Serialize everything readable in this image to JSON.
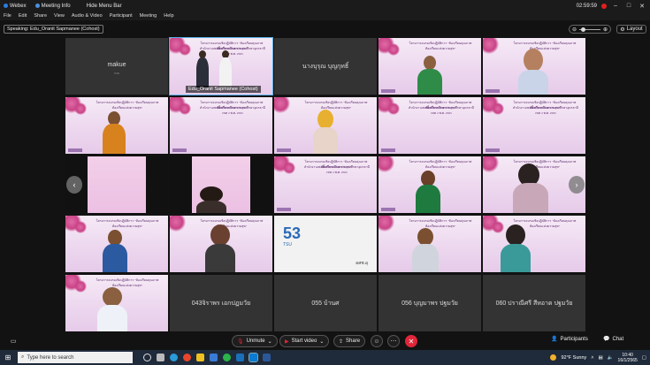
{
  "titlebar": {
    "app_name": "Webex",
    "meeting_info": "Meeting Info",
    "hide_menu_bar": "Hide Menu Bar",
    "timer": "02:59:59",
    "min": "–",
    "max": "□",
    "close": "✕"
  },
  "menu": [
    "File",
    "Edit",
    "Share",
    "View",
    "Audio & Video",
    "Participant",
    "Meeting",
    "Help"
  ],
  "speaking": "Speaking: Edu_Oranit Sapmanee (Cohost)",
  "layout_label": "Layout",
  "slide_title": "โครงการอบรมเชิงปฏิบัติการ \"ห้องเรียนคุณภาพ ห้องเรียนแห่งความสุข\"",
  "slide_subtitle": "สำนักงานเขตพื้นที่การศึกษาประถมศึกษาอุดรธานี เขต 2 พ.ศ. 2565",
  "tiles": {
    "t1_name": "makue",
    "t1_sub": "ma",
    "t2_name": "Edu_Oranit Sapmanee (Cohost)",
    "t3_name": "นางบุรุณ บุญกุทธิ์",
    "t21_name": "043จิราพร เอกปฏมวัย",
    "t22_name": "055 บ้านศ",
    "t23_name": "056 บุญมาพร ปฐมวัย",
    "t24_name": "060 ปราณีศรี สีหอาด ปฐมวัย",
    "logo_text": "53",
    "logo_small": "TSU",
    "logo_footer": "อสช.อุ"
  },
  "controls": {
    "unmute": "Unmute",
    "start_video": "Start video",
    "share": "Share",
    "participants": "Participants",
    "chat": "Chat"
  },
  "taskbar": {
    "search_placeholder": "Type here to search",
    "weather": "92°F  Sunny",
    "time": "10:40",
    "date": "16/1/2565"
  }
}
